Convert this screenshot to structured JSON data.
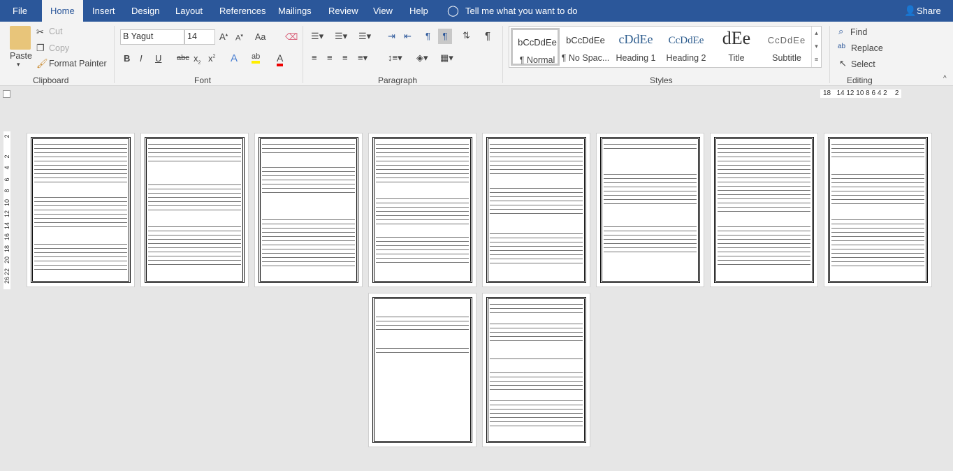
{
  "tabs": [
    "File",
    "Home",
    "Insert",
    "Design",
    "Layout",
    "References",
    "Mailings",
    "Review",
    "View",
    "Help"
  ],
  "tell_me": "Tell me what you want to do",
  "share": "Share",
  "clipboard": {
    "paste": "Paste",
    "cut": "Cut",
    "copy": "Copy",
    "format_painter": "Format Painter",
    "label": "Clipboard"
  },
  "font": {
    "name": "B Yagut",
    "size": "14",
    "label": "Font",
    "change_case": "Aa"
  },
  "paragraph": {
    "label": "Paragraph"
  },
  "styles": {
    "label": "Styles",
    "items": [
      {
        "preview": "bCcDdEe",
        "name": "¶ Normal"
      },
      {
        "preview": "bCcDdEe",
        "name": "¶ No Spac..."
      },
      {
        "preview": "cDdEe",
        "name": "Heading 1"
      },
      {
        "preview": "CcDdEe",
        "name": "Heading 2"
      },
      {
        "preview": "dEe",
        "name": "Title"
      },
      {
        "preview": "CcDdEe",
        "name": "Subtitle"
      }
    ]
  },
  "editing": {
    "label": "Editing",
    "find": "Find",
    "replace": "Replace",
    "select": "Select"
  },
  "ruler": {
    "horizontal": "18   14 12 10 8 6 4 2    2",
    "vertical": [
      "2",
      "2",
      "4",
      "6",
      "8",
      "10",
      "12",
      "14",
      "16",
      "18",
      "20",
      "22",
      "26"
    ]
  },
  "document": {
    "page_count": 10,
    "colors": {
      "ribbon": "#2b579a",
      "canvas": "#e6e6e6"
    }
  }
}
